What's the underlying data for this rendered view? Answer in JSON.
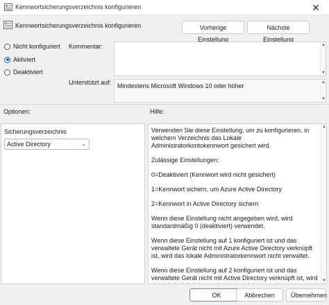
{
  "window": {
    "title": "Kennwortsicherungsverzeichnis konfigurieren",
    "close_glyph": "✕"
  },
  "header": {
    "title": "Kennwortsicherungsverzeichnis konfigurieren",
    "prev_button": "Vorherige Einstellung",
    "next_button": "Nächste Einstellung"
  },
  "state": {
    "options": [
      {
        "label": "Nicht konfiguriert",
        "checked": false
      },
      {
        "label": "Aktiviert",
        "checked": true
      },
      {
        "label": "Deaktiviert",
        "checked": false
      }
    ]
  },
  "comment": {
    "label": "Kommentar:",
    "value": ""
  },
  "supported": {
    "label": "Unterstützt auf:",
    "value": "Mindestens Microsoft Windows 10 oder höher"
  },
  "options_section": {
    "label": "Optionen:",
    "field_label": "Sicherungsverzeichnis",
    "dropdown_value": "Active Directory"
  },
  "help_section": {
    "label": "Hilfe:",
    "paragraphs": [
      "Verwenden Sie diese Einstellung, um zu konfigurieren, in welchem Verzeichnis das Lokale Administratorkontokennwort gesichert wird.",
      "Zulässige Einstellungen:",
      "0=Deaktiviert (Kennwort wird nicht gesichert)",
      "1=Kennwort sichern, um Azure Active Directory",
      "2=Kennwort in Active Directory sichern",
      "Wenn diese Einstellung nicht angegeben wird, wird standardmäßig 0 (deaktiviert) verwendet.",
      "Wenn diese Einstellung auf 1 konfiguriert ist und das verwaltete Gerät nicht mit Azure Active Directory verknüpft ist, wird das lokale Administratorkennwort nicht verwaltet.",
      "Wenn diese Einstellung auf 2 konfiguriert ist und das verwaltete Gerät nicht mit Active Directory verknüpft ist, wird das lokale Administratorkennwort nicht verwaltet."
    ]
  },
  "footer": {
    "ok": "OK",
    "cancel": "Abbrechen",
    "apply": "Übernehmen"
  }
}
